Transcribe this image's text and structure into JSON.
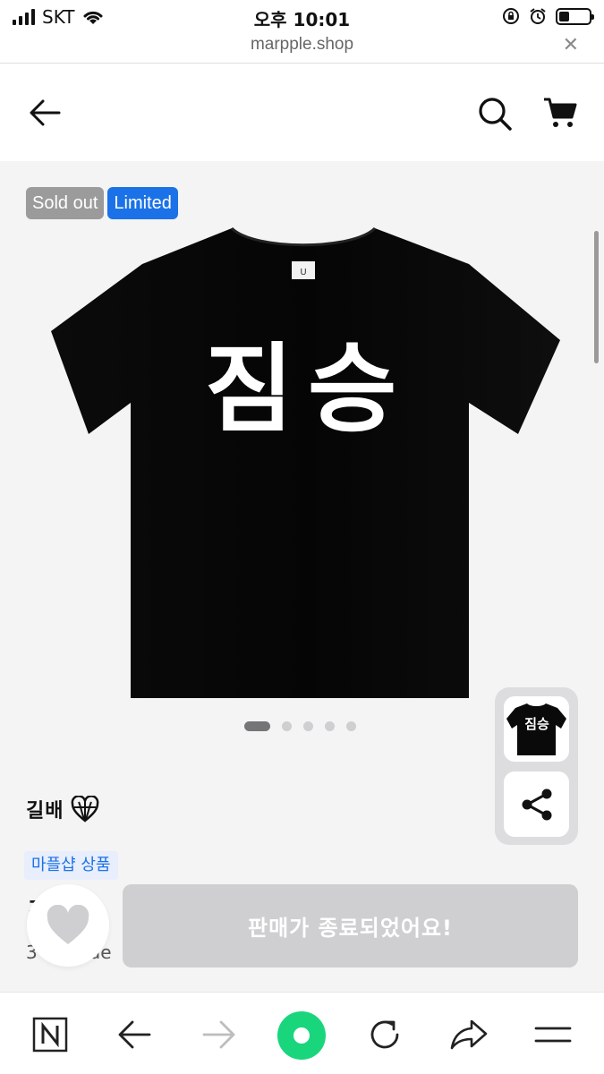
{
  "status_bar": {
    "carrier": "SKT",
    "time": "오후 10:01",
    "battery_level": 0.35
  },
  "browser": {
    "url": "marpple.shop"
  },
  "header": {
    "back_icon": "back-arrow-icon",
    "search_icon": "search-icon",
    "cart_icon": "cart-icon"
  },
  "product": {
    "badges": [
      "Sold out",
      "Limited"
    ],
    "image_text": "짐승",
    "thumbnail_text": "짐승",
    "carousel": {
      "total": 5,
      "active_index": 0
    },
    "seller_name": "길배",
    "shop_tag": "마플샵 상품",
    "title_partial": "ㅈ",
    "subtitle_partial": "3",
    "subtitle_partial_2": "alue"
  },
  "actions": {
    "cta_label": "판매가 종료되었어요!",
    "wishlist_icon": "heart-icon",
    "share_icon": "share-icon"
  },
  "colors": {
    "accent": "#1b72e8",
    "soldout_badge": "#9b9b9b",
    "cta_disabled": "#cfcfd2",
    "home_button": "#19d67c"
  }
}
